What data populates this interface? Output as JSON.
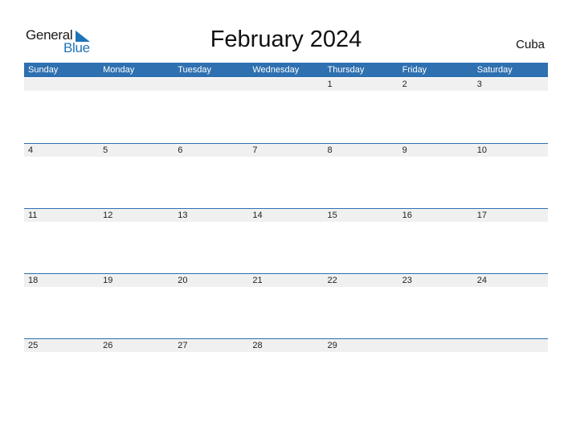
{
  "logo": {
    "general": "General",
    "blue": "Blue"
  },
  "title": "February 2024",
  "country": "Cuba",
  "accent_color": "#2e70b0",
  "weekdays": [
    "Sunday",
    "Monday",
    "Tuesday",
    "Wednesday",
    "Thursday",
    "Friday",
    "Saturday"
  ],
  "weeks": [
    [
      "",
      "",
      "",
      "",
      "1",
      "2",
      "3"
    ],
    [
      "4",
      "5",
      "6",
      "7",
      "8",
      "9",
      "10"
    ],
    [
      "11",
      "12",
      "13",
      "14",
      "15",
      "16",
      "17"
    ],
    [
      "18",
      "19",
      "20",
      "21",
      "22",
      "23",
      "24"
    ],
    [
      "25",
      "26",
      "27",
      "28",
      "29",
      "",
      ""
    ]
  ]
}
